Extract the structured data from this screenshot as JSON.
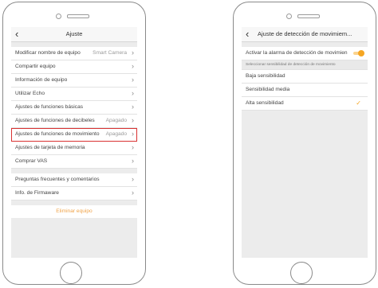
{
  "left": {
    "title": "Ajuste",
    "back_icon": "‹",
    "items_group1": [
      {
        "label": "Modificar nombre de equipo",
        "value": "Smart Camera"
      },
      {
        "label": "Compartir equipo",
        "value": ""
      },
      {
        "label": "Información de equipo",
        "value": ""
      },
      {
        "label": "Utilizar Echo",
        "value": ""
      },
      {
        "label": "Ajustes de funciones básicas",
        "value": ""
      },
      {
        "label": "Ajustes de funciones de decibeles",
        "value": "Apagado"
      },
      {
        "label": "Ajustes de funciones de movimiento",
        "value": "Apagado"
      },
      {
        "label": "Ajustes de tarjeta de memoria",
        "value": ""
      },
      {
        "label": "Comprar VAS",
        "value": ""
      }
    ],
    "items_group2": [
      {
        "label": "Preguntas frecuentes y comentarios"
      },
      {
        "label": "Info. de Firmaware"
      }
    ],
    "delete_label": "Eliminar equipo"
  },
  "right": {
    "title": "Ajuste de detección de movimiem...",
    "alarm_label": "Activar la alarma de detección de movimien",
    "alarm_on": true,
    "section_label": "Seleccionar sensibilidad de detección de movimiento",
    "options": [
      {
        "label": "Baja sensibilidad"
      },
      {
        "label": "Sensibilidad media"
      },
      {
        "label": "Alta sensibilidad",
        "selected": true
      }
    ]
  },
  "colors": {
    "accent": "#f5a623",
    "highlight_border": "#d93232",
    "delete_text": "#f0a44a"
  },
  "icons": {
    "chevron": "chevron-right-icon",
    "back": "back-arrow-icon",
    "check": "checkmark-icon"
  }
}
